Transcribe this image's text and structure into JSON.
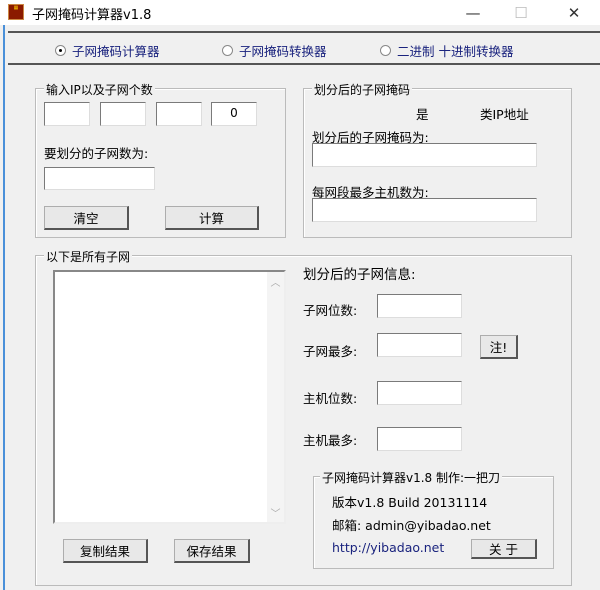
{
  "window": {
    "title": "子网掩码计算器v1.8",
    "minimize": "—",
    "maximize": "☐",
    "close": "✕"
  },
  "modes": [
    {
      "label": "子网掩码计算器",
      "selected": true
    },
    {
      "label": "子网掩码转换器",
      "selected": false
    },
    {
      "label": "二进制 十进制转换器",
      "selected": false
    }
  ],
  "input_group": {
    "legend": "输入IP以及子网个数",
    "ip": [
      "",
      "",
      "",
      "0"
    ],
    "subnet_count_label": "要划分的子网数为:",
    "subnet_count": "",
    "clear": "清空",
    "calc": "计算"
  },
  "mask_group": {
    "legend": "划分后的子网掩码",
    "is": "是",
    "class_suffix": "类IP地址",
    "mask_label": "划分后的子网掩码为:",
    "mask": "",
    "hosts_label": "每网段最多主机数为:",
    "hosts": ""
  },
  "subnets_group": {
    "legend": "以下是所有子网",
    "list": "",
    "copy": "复制结果",
    "save": "保存结果"
  },
  "info": {
    "title": "划分后的子网信息:",
    "subnet_bits_label": "子网位数:",
    "subnet_max_label": "子网最多:",
    "note": "注!",
    "host_bits_label": "主机位数:",
    "host_max_label": "主机最多:",
    "subnet_bits": "",
    "subnet_max": "",
    "host_bits": "",
    "host_max": ""
  },
  "about": {
    "legend": "子网掩码计算器v1.8  制作:一把刀",
    "version": "版本v1.8  Build 20131114",
    "email": "邮箱: admin@yibadao.net",
    "link": "http://yibadao.net",
    "about_button": "关 于"
  }
}
